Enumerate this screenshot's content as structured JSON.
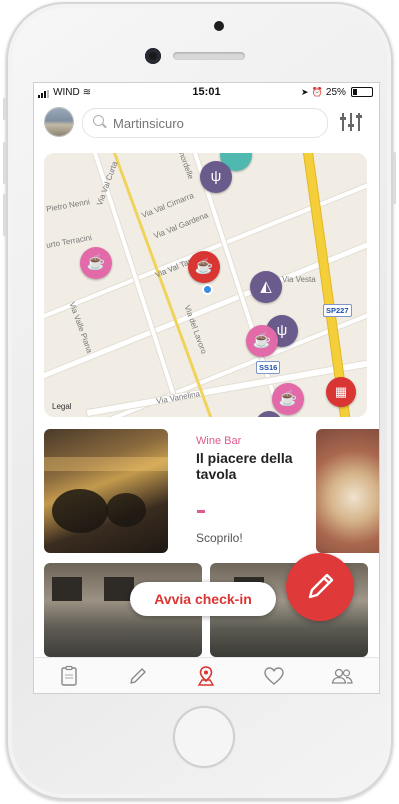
{
  "status_bar": {
    "carrier": "WIND",
    "time": "15:01",
    "battery": "25%"
  },
  "search": {
    "placeholder": "Martinsicuro"
  },
  "map": {
    "street_labels": [
      "Via Val Curta",
      "Pietro Nenni",
      "Via Val Cimarra",
      "Via Val Gardena",
      "urto Terracini",
      "Via Val Taro",
      "Via Valle Piana",
      "Via del Lavoro",
      "Via Vanelina",
      "Via Vesta",
      "nordelle"
    ],
    "road_tags": [
      "SP227",
      "SS16"
    ],
    "legal": "Legal",
    "pins": [
      "cafe",
      "restaurant",
      "pizza",
      "cafe",
      "restaurant",
      "cafe",
      "cafe",
      "teal",
      "purple"
    ]
  },
  "featured": {
    "category": "Wine Bar",
    "title": "Il piacere della tavola",
    "cta": "Scoprilo!"
  },
  "checkin_label": "Avvia check-in",
  "colors": {
    "accent": "#d93532",
    "pink": "#e36aa8",
    "purple": "#6b5b8c"
  },
  "tabs": [
    "clipboard-icon",
    "pencil-icon",
    "map-pin-user-icon",
    "heart-icon",
    "users-icon"
  ]
}
